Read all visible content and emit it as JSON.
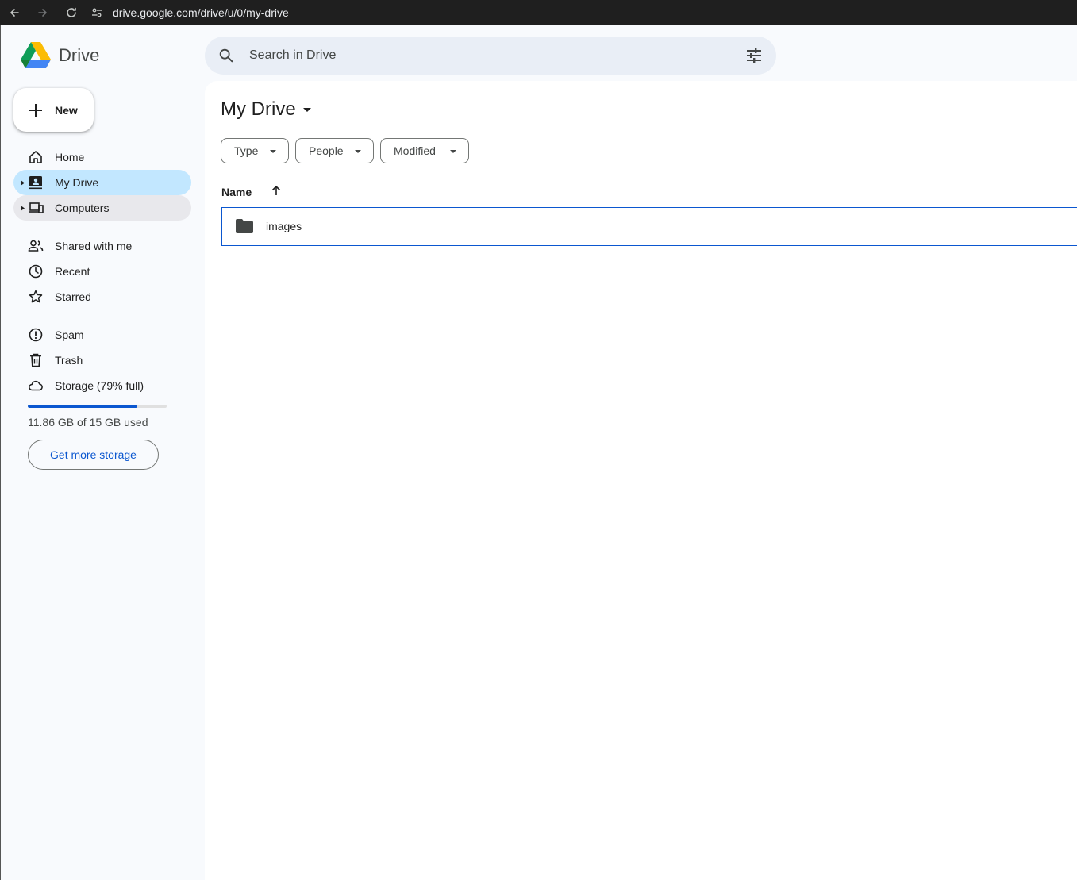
{
  "browser": {
    "url": "drive.google.com/drive/u/0/my-drive"
  },
  "app": {
    "name": "Drive"
  },
  "search": {
    "placeholder": "Search in Drive",
    "value": ""
  },
  "sidebar": {
    "new_label": "New",
    "items": [
      {
        "label": "Home",
        "icon": "home-icon"
      },
      {
        "label": "My Drive",
        "icon": "my-drive-icon",
        "active": true
      },
      {
        "label": "Computers",
        "icon": "computers-icon"
      },
      {
        "label": "Shared with me",
        "icon": "people-icon"
      },
      {
        "label": "Recent",
        "icon": "clock-icon"
      },
      {
        "label": "Starred",
        "icon": "star-icon"
      },
      {
        "label": "Spam",
        "icon": "spam-icon"
      },
      {
        "label": "Trash",
        "icon": "trash-icon"
      },
      {
        "label": "Storage (79% full)",
        "icon": "cloud-icon"
      }
    ],
    "storage": {
      "used_fraction": 0.79,
      "text": "11.86 GB of 15 GB used",
      "button_label": "Get more storage"
    }
  },
  "main": {
    "title": "My Drive",
    "filters": [
      "Type",
      "People",
      "Modified"
    ],
    "column_name": "Name",
    "files": [
      {
        "name": "images",
        "icon": "folder-icon"
      }
    ]
  },
  "colors": {
    "accent": "#0b57d0",
    "active_nav": "#c2e7ff",
    "search_bg": "#e9eef6"
  }
}
